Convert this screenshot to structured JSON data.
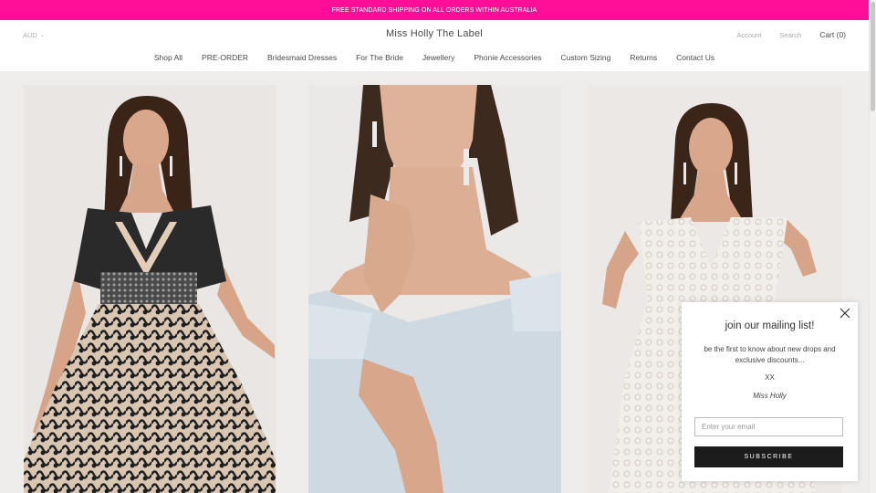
{
  "announcement": {
    "text": "FREE STANDARD SHIPPING ON ALL ORDERS WITHIN AUSTRALIA"
  },
  "header": {
    "currency": "AUD",
    "brand": "Miss Holly The Label",
    "account": "Account",
    "search": "Search",
    "cart": "Cart (0)"
  },
  "nav": {
    "items": [
      {
        "label": "Shop All"
      },
      {
        "label": "PRE-ORDER"
      },
      {
        "label": "Bridesmaid Dresses"
      },
      {
        "label": "For The Bride"
      },
      {
        "label": "Jewellery"
      },
      {
        "label": "Phonie Accessories"
      },
      {
        "label": "Custom Sizing"
      },
      {
        "label": "Returns"
      },
      {
        "label": "Contact Us"
      }
    ]
  },
  "products": [
    {
      "image": "model-black-lace-dress-photo"
    },
    {
      "image": "model-light-blue-off-shoulder-dress-photo"
    },
    {
      "image": "model-white-lace-dress-photo"
    }
  ],
  "popup": {
    "title": "join our mailing list!",
    "description": "be the first to know about new drops and exclusive discounts...",
    "xx": "XX",
    "signature": "Miss Holly",
    "email_placeholder": "Enter your email",
    "subscribe_label": "SUBSCRIBE",
    "close_icon": "close-icon"
  },
  "colors": {
    "announcement_bg": "#ff0f97",
    "button_bg": "#1c1c1c",
    "page_bg": "#efedec"
  }
}
